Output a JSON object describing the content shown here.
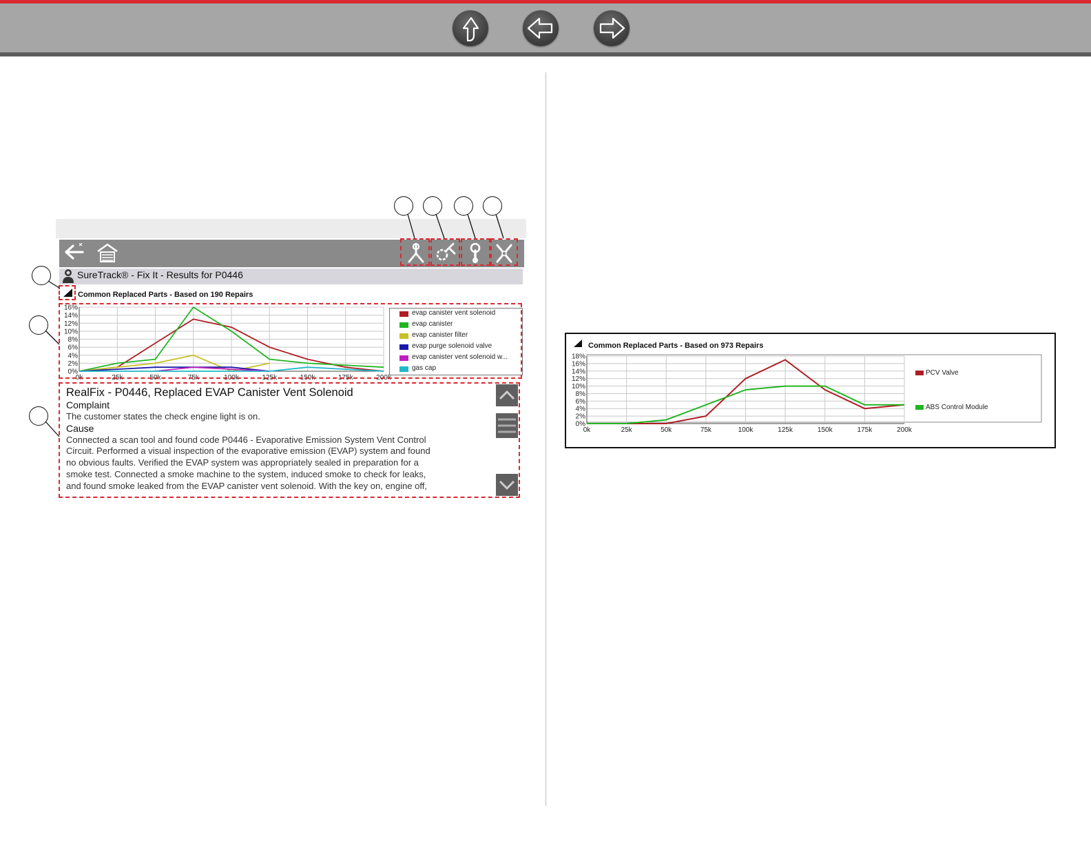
{
  "nav": {
    "buttons": [
      {
        "name": "nav-up-button",
        "icon": "up-arrow-icon"
      },
      {
        "name": "nav-back-button",
        "icon": "left-arrow-icon"
      },
      {
        "name": "nav-forward-button",
        "icon": "right-arrow-icon"
      }
    ],
    "colors": {
      "accent": "#d9282f",
      "bar": "#a6a6a6"
    }
  },
  "screenshot": {
    "toolbar_icons": [
      "back-arrow-icon",
      "home-garage-icon",
      "suretrack-icon",
      "common-replaced-parts-icon",
      "realfix-icon",
      "tools-icon"
    ],
    "title": "SureTrack® - Fix It - Results for P0446",
    "section_title": "Common Replaced Parts - Based on 190 Repairs",
    "realfix": {
      "title": "RealFix - P0446, Replaced EVAP Canister Vent Solenoid",
      "complaint_heading": "Complaint",
      "complaint_text": "The customer states the check engine light is on.",
      "cause_heading": "Cause",
      "cause_lines": [
        "Connected a scan tool and found code P0446 - Evaporative Emission System Vent Control",
        "Circuit. Performed a visual inspection of the evaporative emission (EVAP) system and found",
        "no obvious faults. Verified the EVAP system was appropriately sealed in preparation for a",
        "smoke test. Connected a smoke machine to the system, induced smoke to check for leaks,",
        "and found smoke leaked from the EVAP canister vent solenoid. With the key on, engine off,"
      ]
    }
  },
  "chart_data": [
    {
      "type": "line",
      "title": "Common Replaced Parts - Based on 190 Repairs",
      "x": [
        "0k",
        "25k",
        "50k",
        "75k",
        "100k",
        "125k",
        "150k",
        "175k",
        "200k"
      ],
      "yticks": [
        "0%",
        "2%",
        "4%",
        "6%",
        "8%",
        "10%",
        "12%",
        "14%",
        "16%"
      ],
      "ylim": [
        0,
        16
      ],
      "legend_position": "right",
      "series": [
        {
          "name": "evap canister vent solenoid",
          "color": "#b01e23",
          "values": [
            0,
            1,
            7,
            13,
            11,
            6,
            3,
            1,
            0
          ]
        },
        {
          "name": "evap canister",
          "color": "#22b522",
          "values": [
            0,
            2,
            3,
            16,
            10,
            3,
            2,
            1.5,
            1
          ]
        },
        {
          "name": "evap canister filter",
          "color": "#c8c028",
          "values": [
            0,
            1,
            2,
            4,
            0,
            2,
            null,
            null,
            null
          ]
        },
        {
          "name": "evap purge solenoid valve",
          "color": "#1a1aa8",
          "values": [
            0,
            0.5,
            1,
            1,
            1,
            0,
            null,
            null,
            null
          ]
        },
        {
          "name": "evap canister vent solenoid w...",
          "color": "#c020c0",
          "values": [
            null,
            null,
            0,
            1,
            0.5,
            0,
            null,
            null,
            null
          ]
        },
        {
          "name": "gas cap",
          "color": "#20b8c8",
          "values": [
            0,
            0,
            0,
            0,
            0,
            0,
            1,
            0.5,
            0
          ]
        }
      ]
    },
    {
      "type": "line",
      "title": "Common Replaced Parts - Based on 973 Repairs",
      "x": [
        "0k",
        "25k",
        "50k",
        "75k",
        "100k",
        "125k",
        "150k",
        "175k",
        "200k"
      ],
      "yticks": [
        "0%",
        "2%",
        "4%",
        "6%",
        "8%",
        "10%",
        "12%",
        "14%",
        "16%",
        "18%"
      ],
      "ylim": [
        0,
        18
      ],
      "legend_position": "right",
      "series": [
        {
          "name": "PCV Valve",
          "color": "#b01e23",
          "values": [
            null,
            0,
            0,
            2,
            12,
            17,
            9,
            4,
            5
          ]
        },
        {
          "name": "ABS Control Module",
          "color": "#22b522",
          "values": [
            0,
            0,
            1,
            5,
            9,
            10,
            10,
            5,
            5
          ]
        }
      ]
    }
  ],
  "callouts": {
    "count": 7
  }
}
